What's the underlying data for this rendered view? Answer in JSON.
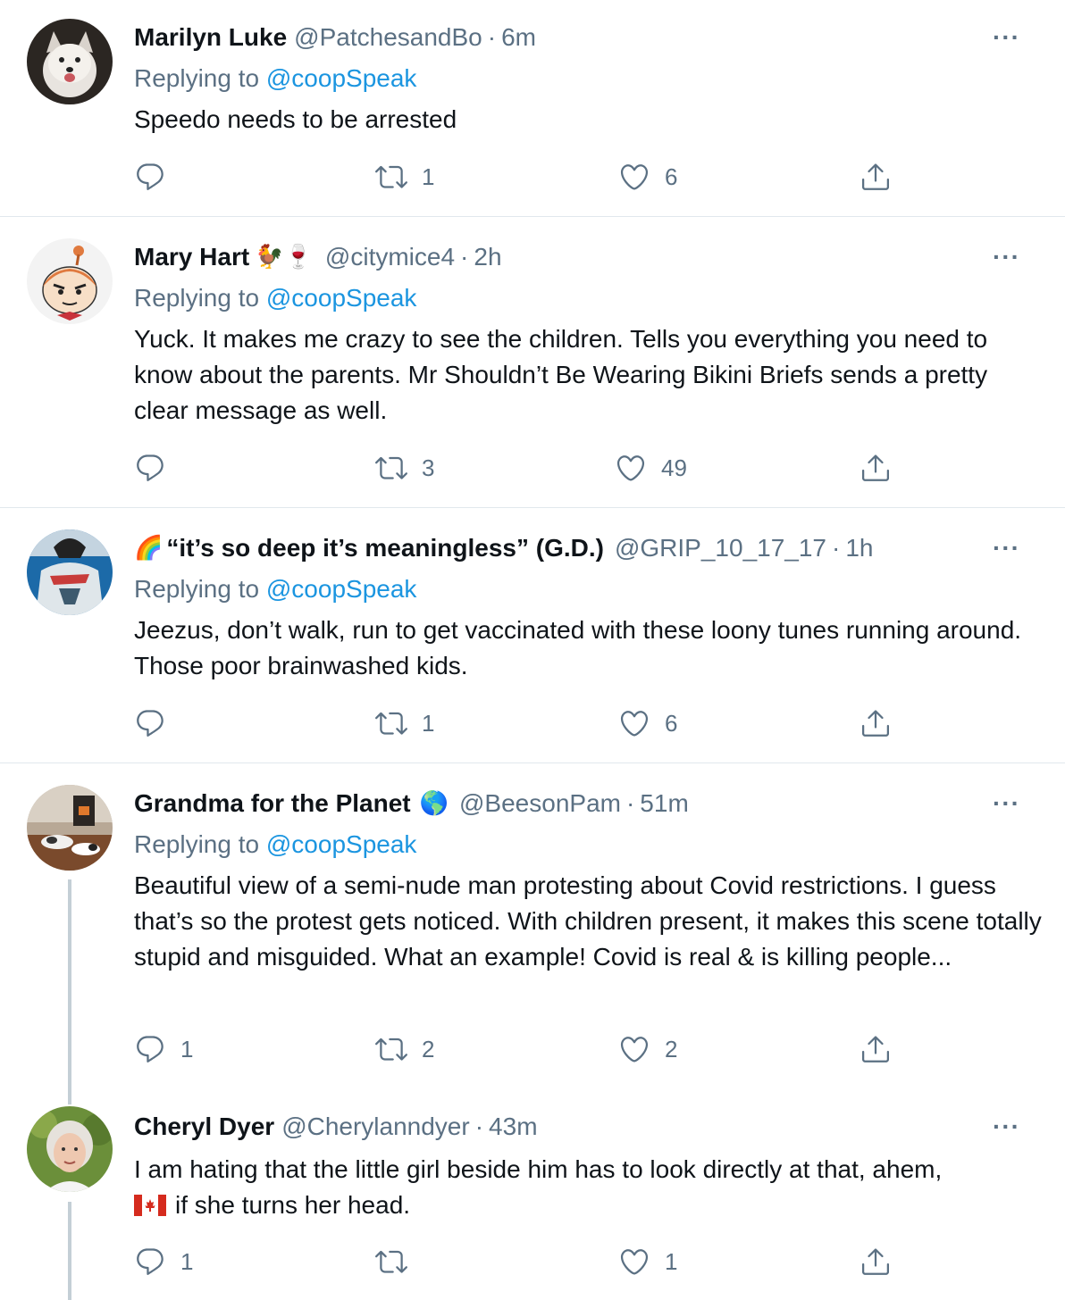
{
  "tweets": [
    {
      "name": "Marilyn Luke",
      "name_suffix": "",
      "handle": "@PatchesandBo",
      "time": "6m",
      "replying_prefix": "Replying to ",
      "replying_to": "@coopSpeak",
      "text": "Speedo needs to be arrested",
      "replies": "",
      "retweets": "1",
      "likes": "6"
    },
    {
      "name": "Mary Hart",
      "name_suffix": "🐓🍷",
      "handle": "@citymice4",
      "time": "2h",
      "replying_prefix": "Replying to ",
      "replying_to": "@coopSpeak",
      "text": "Yuck. It makes me crazy to see the children. Tells you everything you need to know about the parents. Mr Shouldn’t Be Wearing Bikini Briefs sends a pretty clear message as well.",
      "replies": "",
      "retweets": "3",
      "likes": "49"
    },
    {
      "name": "“it’s so deep it’s meaningless” (G.D.)",
      "name_prefix": "🌈",
      "handle": "@GRIP_10_17_17",
      "time": "1h",
      "replying_prefix": "Replying to ",
      "replying_to": "@coopSpeak",
      "text": "Jeezus, don’t walk, run to get vaccinated with these loony tunes running around.  Those poor brainwashed kids.",
      "replies": "",
      "retweets": "1",
      "likes": "6"
    },
    {
      "name": "Grandma for the Planet",
      "name_suffix": "🌎",
      "handle": "@BeesonPam",
      "time": "51m",
      "replying_prefix": "Replying to ",
      "replying_to": "@coopSpeak",
      "text": "Beautiful view of a semi-nude man protesting about Covid restrictions. I guess that’s so the protest gets noticed. With children present, it makes this scene totally stupid and misguided. What an example!  Covid is real & is killing people...",
      "replies": "1",
      "retweets": "2",
      "likes": "2"
    },
    {
      "name": "Cheryl Dyer",
      "name_suffix": "",
      "handle": "@Cherylanndyer",
      "time": "43m",
      "text_line1": "I am hating that the little girl beside him has to look directly at that, ahem,",
      "text_line2": "if she turns her head.",
      "replies": "1",
      "retweets": "",
      "likes": "1"
    }
  ],
  "separator": "·",
  "more_label": "···",
  "icons": {
    "reply": "reply-icon",
    "retweet": "retweet-icon",
    "like": "heart-icon",
    "share": "share-icon",
    "more": "more-icon",
    "flag": "canada-flag-icon"
  },
  "colors": {
    "link": "#1b95e0",
    "secondary": "#5b7083",
    "divider": "#e1e8ed",
    "thread": "#c4cfd6"
  }
}
